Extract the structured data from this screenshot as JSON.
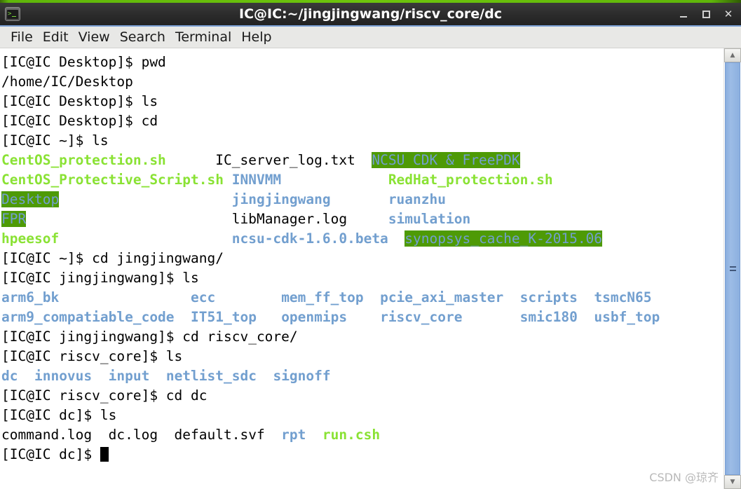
{
  "window": {
    "title": "IC@IC:~/jingjingwang/riscv_core/dc",
    "icon": "terminal-icon",
    "controls": {
      "minimize": "–",
      "maximize": "□",
      "close": "✕"
    }
  },
  "menubar": {
    "items": [
      {
        "label": "File"
      },
      {
        "label": "Edit"
      },
      {
        "label": "View"
      },
      {
        "label": "Search"
      },
      {
        "label": "Terminal"
      },
      {
        "label": "Help"
      }
    ]
  },
  "terminal": {
    "lines": [
      {
        "segments": [
          {
            "text": "[IC@IC Desktop]$ pwd",
            "style": "default"
          }
        ]
      },
      {
        "segments": [
          {
            "text": "/home/IC/Desktop",
            "style": "default"
          }
        ]
      },
      {
        "segments": [
          {
            "text": "[IC@IC Desktop]$ ls",
            "style": "default"
          }
        ]
      },
      {
        "segments": [
          {
            "text": "[IC@IC Desktop]$ cd",
            "style": "default"
          }
        ]
      },
      {
        "segments": [
          {
            "text": "[IC@IC ~]$ ls",
            "style": "default"
          }
        ]
      },
      {
        "segments": [
          {
            "text": "CentOS_protection.sh",
            "style": "exec"
          },
          {
            "text": "      ",
            "style": "default"
          },
          {
            "text": "IC_server_log.txt",
            "style": "default"
          },
          {
            "text": "  ",
            "style": "default"
          },
          {
            "text": "NCSU CDK & FreePDK",
            "style": "sticky"
          }
        ]
      },
      {
        "segments": [
          {
            "text": "CentOS_Protective_Script.sh",
            "style": "exec"
          },
          {
            "text": " ",
            "style": "default"
          },
          {
            "text": "INNVMM",
            "style": "dir"
          },
          {
            "text": "             ",
            "style": "default"
          },
          {
            "text": "RedHat_protection.sh",
            "style": "exec"
          }
        ]
      },
      {
        "segments": [
          {
            "text": "Desktop",
            "style": "sticky"
          },
          {
            "text": "                     ",
            "style": "default"
          },
          {
            "text": "jingjingwang",
            "style": "dir"
          },
          {
            "text": "       ",
            "style": "default"
          },
          {
            "text": "ruanzhu",
            "style": "dir"
          }
        ]
      },
      {
        "segments": [
          {
            "text": "FPR",
            "style": "sticky"
          },
          {
            "text": "                         ",
            "style": "default"
          },
          {
            "text": "libManager.log",
            "style": "default"
          },
          {
            "text": "     ",
            "style": "default"
          },
          {
            "text": "simulation",
            "style": "dir"
          }
        ]
      },
      {
        "segments": [
          {
            "text": "hpeesof",
            "style": "exec"
          },
          {
            "text": "                     ",
            "style": "default"
          },
          {
            "text": "ncsu-cdk-1.6.0.beta",
            "style": "dir"
          },
          {
            "text": "  ",
            "style": "default"
          },
          {
            "text": "synopsys_cache_K-2015.06",
            "style": "sticky"
          }
        ]
      },
      {
        "segments": [
          {
            "text": "[IC@IC ~]$ cd jingjingwang/",
            "style": "default"
          }
        ]
      },
      {
        "segments": [
          {
            "text": "[IC@IC jingjingwang]$ ls",
            "style": "default"
          }
        ]
      },
      {
        "segments": [
          {
            "text": "arm6_bk",
            "style": "dir"
          },
          {
            "text": "                ",
            "style": "default"
          },
          {
            "text": "ecc",
            "style": "dir"
          },
          {
            "text": "        ",
            "style": "default"
          },
          {
            "text": "mem_ff_top",
            "style": "dir"
          },
          {
            "text": "  ",
            "style": "default"
          },
          {
            "text": "pcie_axi_master",
            "style": "dir"
          },
          {
            "text": "  ",
            "style": "default"
          },
          {
            "text": "scripts",
            "style": "dir"
          },
          {
            "text": "  ",
            "style": "default"
          },
          {
            "text": "tsmcN65",
            "style": "dir"
          }
        ]
      },
      {
        "segments": [
          {
            "text": "arm9_compatiable_code",
            "style": "dir"
          },
          {
            "text": "  ",
            "style": "default"
          },
          {
            "text": "IT51_top",
            "style": "dir"
          },
          {
            "text": "   ",
            "style": "default"
          },
          {
            "text": "openmips",
            "style": "dir"
          },
          {
            "text": "    ",
            "style": "default"
          },
          {
            "text": "riscv_core",
            "style": "dir"
          },
          {
            "text": "       ",
            "style": "default"
          },
          {
            "text": "smic180",
            "style": "dir"
          },
          {
            "text": "  ",
            "style": "default"
          },
          {
            "text": "usbf_top",
            "style": "dir"
          }
        ]
      },
      {
        "segments": [
          {
            "text": "[IC@IC jingjingwang]$ cd riscv_core/",
            "style": "default"
          }
        ]
      },
      {
        "segments": [
          {
            "text": "[IC@IC riscv_core]$ ls",
            "style": "default"
          }
        ]
      },
      {
        "segments": [
          {
            "text": "dc",
            "style": "dir"
          },
          {
            "text": "  ",
            "style": "default"
          },
          {
            "text": "innovus",
            "style": "dir"
          },
          {
            "text": "  ",
            "style": "default"
          },
          {
            "text": "input",
            "style": "dir"
          },
          {
            "text": "  ",
            "style": "default"
          },
          {
            "text": "netlist_sdc",
            "style": "dir"
          },
          {
            "text": "  ",
            "style": "default"
          },
          {
            "text": "signoff",
            "style": "dir"
          }
        ]
      },
      {
        "segments": [
          {
            "text": "[IC@IC riscv_core]$ cd dc",
            "style": "default"
          }
        ]
      },
      {
        "segments": [
          {
            "text": "[IC@IC dc]$ ls",
            "style": "default"
          }
        ]
      },
      {
        "segments": [
          {
            "text": "command.log  dc.log  default.svf",
            "style": "default"
          },
          {
            "text": "  ",
            "style": "default"
          },
          {
            "text": "rpt",
            "style": "dir"
          },
          {
            "text": "  ",
            "style": "default"
          },
          {
            "text": "run.csh",
            "style": "exec"
          }
        ]
      },
      {
        "segments": [
          {
            "text": "[IC@IC dc]$ ",
            "style": "default"
          },
          {
            "text": "",
            "style": "cursor"
          }
        ]
      }
    ]
  },
  "scrollbar": {
    "up_arrow": "▲",
    "down_arrow": "▼"
  },
  "watermark": {
    "text": "CSDN @琼齐"
  },
  "colors": {
    "directory": "#729fcf",
    "executable": "#8ae234",
    "sticky_background": "#4e9a06",
    "titlebar": "#2b2b2b",
    "accent_green": "#6ec40c",
    "scrollbar_thumb": "#9dbce6"
  }
}
